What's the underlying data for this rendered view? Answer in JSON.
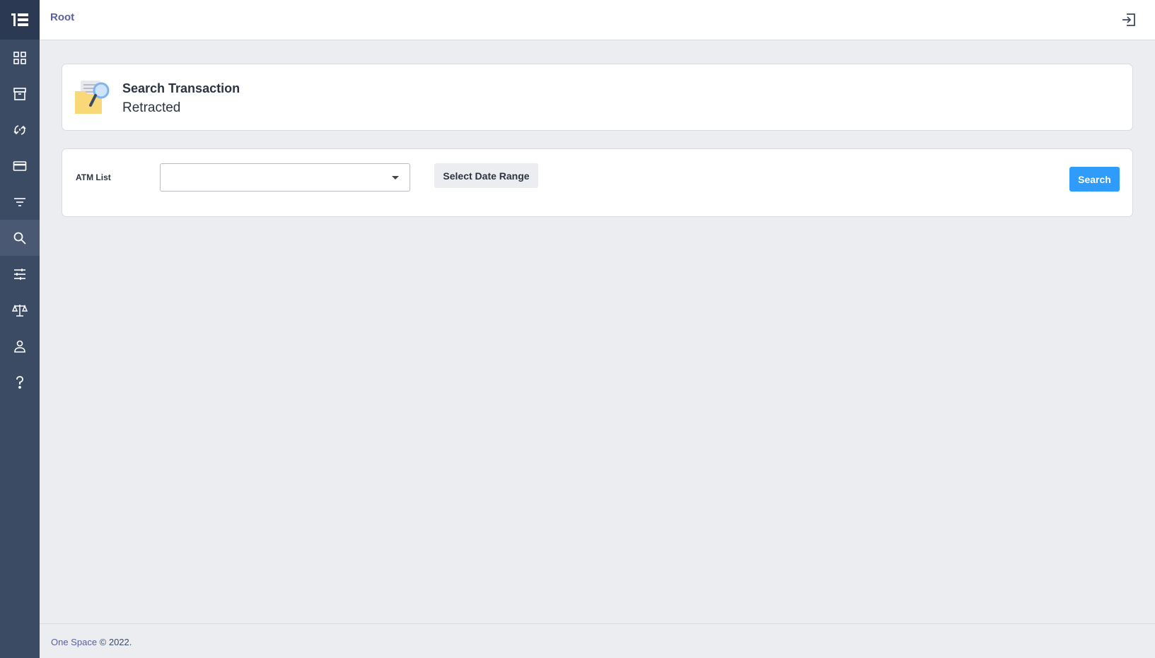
{
  "header": {
    "breadcrumb": "Root",
    "logout_icon": "logout-icon"
  },
  "sidebar": {
    "brand_icon": "brand-logo-icon",
    "items": [
      {
        "icon": "dashboard-grid-icon",
        "active": false
      },
      {
        "icon": "archive-box-icon",
        "active": false
      },
      {
        "icon": "sync-arrows-icon",
        "active": false
      },
      {
        "icon": "credit-card-icon",
        "active": false
      },
      {
        "icon": "filter-lines-icon",
        "active": false
      },
      {
        "icon": "search-icon",
        "active": true
      },
      {
        "icon": "sliders-icon",
        "active": false
      },
      {
        "icon": "balance-scale-icon",
        "active": false
      },
      {
        "icon": "user-icon",
        "active": false
      },
      {
        "icon": "help-question-icon",
        "active": false
      }
    ]
  },
  "page": {
    "title": "Search Transaction",
    "subtitle": "Retracted",
    "title_icon": "folder-search-icon"
  },
  "filters": {
    "atm_label": "ATM List",
    "atm_value": "",
    "date_range_label": "Select Date Range",
    "search_label": "Search"
  },
  "footer": {
    "brand": "One Space",
    "copyright": " © 2022."
  },
  "colors": {
    "sidebar": "#3c4b64",
    "sidebar_active": "#4a5873",
    "accent": "#2f9cfb",
    "link": "#5b5f9e",
    "background": "#ebedf0"
  }
}
